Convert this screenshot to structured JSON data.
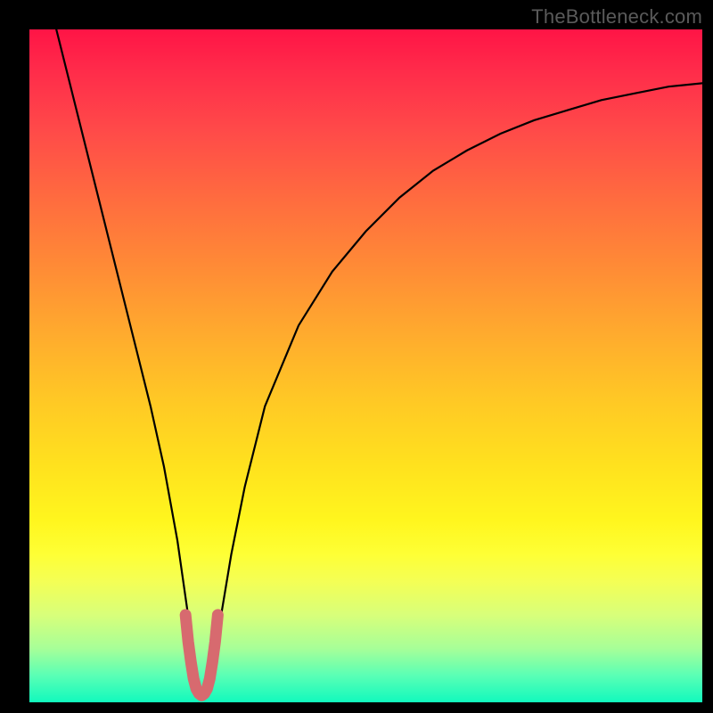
{
  "watermark": "TheBottleneck.com",
  "colors": {
    "frame": "#000000",
    "curve": "#000000",
    "highlight": "#d76a6f",
    "gradient_top": "#ff1446",
    "gradient_bottom": "#11f9bd"
  },
  "chart_data": {
    "type": "line",
    "title": "",
    "xlabel": "",
    "ylabel": "",
    "xlim": [
      0,
      100
    ],
    "ylim": [
      0,
      100
    ],
    "grid": false,
    "series": [
      {
        "name": "bottleneck-curve",
        "x": [
          2,
          4,
          6,
          8,
          10,
          12,
          14,
          16,
          18,
          20,
          22,
          24,
          25,
          26,
          27,
          28,
          30,
          32,
          35,
          40,
          45,
          50,
          55,
          60,
          65,
          70,
          75,
          80,
          85,
          90,
          95,
          100
        ],
        "y": [
          105,
          100,
          92,
          84,
          76,
          68,
          60,
          52,
          44,
          35,
          24,
          10,
          3,
          1,
          3,
          10,
          22,
          32,
          44,
          56,
          64,
          70,
          75,
          79,
          82,
          84.5,
          86.5,
          88,
          89.5,
          90.5,
          91.5,
          92
        ]
      },
      {
        "name": "highlight-bottom",
        "x": [
          23.2,
          23.6,
          24.0,
          24.4,
          24.8,
          25.2,
          25.6,
          26.0,
          26.4,
          26.8,
          27.2,
          27.6,
          28.0
        ],
        "y": [
          13,
          9,
          6,
          3.5,
          2,
          1.3,
          1,
          1.3,
          2,
          3.5,
          6,
          9,
          13
        ]
      }
    ],
    "legend": false,
    "annotations": [
      {
        "text": "TheBottleneck.com",
        "pos": "top-right"
      }
    ]
  }
}
